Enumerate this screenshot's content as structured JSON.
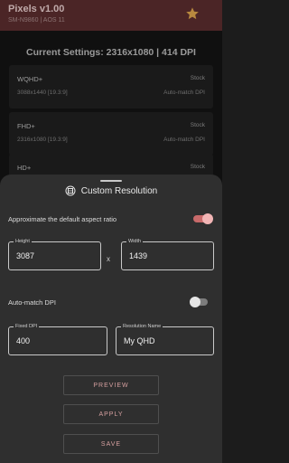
{
  "app": {
    "title": "Pixels v1.00",
    "subtitle": "SM-N9860 | AOS 11",
    "accent": "#e0a84c"
  },
  "current_settings": "Current Settings: 2316x1080 | 414 DPI",
  "presets": [
    {
      "name": "WQHD+",
      "resolution": "3088x1440 [19.3:9]",
      "dpi_status": "Stock",
      "dpi_mode": "Auto-match DPI"
    },
    {
      "name": "FHD+",
      "resolution": "2316x1080 [19.3:9]",
      "dpi_status": "Stock",
      "dpi_mode": "Auto-match DPI"
    },
    {
      "name": "HD+",
      "dpi_status": "Stock"
    }
  ],
  "sheet": {
    "title": "Custom Resolution",
    "approx_label": "Approximate the default aspect ratio",
    "approx_on": true,
    "height_label": "Height",
    "height_value": "3087",
    "x_symbol": "x",
    "width_label": "Width",
    "width_value": "1439",
    "auto_dpi_label": "Auto-match DPI",
    "auto_dpi_on": false,
    "fixed_dpi_label": "Fixed DPI",
    "fixed_dpi_value": "400",
    "res_name_label": "Resolution Name",
    "res_name_value": "My QHD",
    "buttons": {
      "preview": "PREVIEW",
      "apply": "APPLY",
      "save": "SAVE"
    }
  },
  "colors": {
    "toggle_on_track": "#c86a6a",
    "toggle_on_thumb": "#f2b5b5",
    "button_text": "#d6a0a0"
  }
}
